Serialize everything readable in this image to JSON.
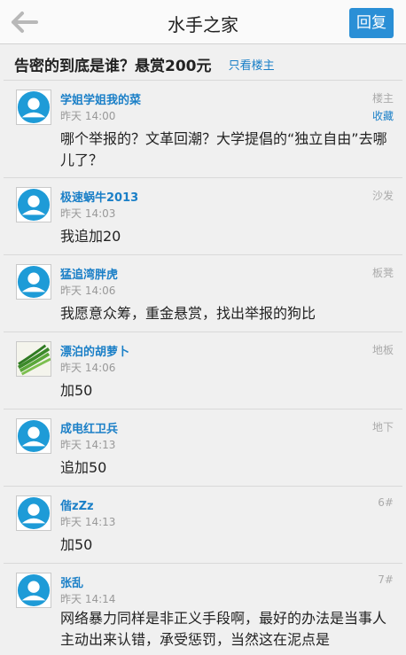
{
  "header": {
    "title": "水手之家",
    "reply_label": "回复"
  },
  "thread": {
    "title": "告密的到底是谁？悬赏200元",
    "only_op_label": "只看楼主"
  },
  "posts": [
    {
      "author": "学姐学姐我的菜",
      "time": "昨天 14:00",
      "floor": "楼主",
      "fav": "收藏",
      "content": "哪个举报的？文革回潮？大学提倡的“独立自由”去哪儿了？"
    },
    {
      "author": "极速蜗牛2013",
      "time": "昨天 14:03",
      "floor": "沙发",
      "content": "我追加20"
    },
    {
      "author": "猛追湾胖虎",
      "time": "昨天 14:06",
      "floor": "板凳",
      "content": "我愿意众筹，重金悬赏，找出举报的狗比"
    },
    {
      "author": "漂泊的胡萝卜",
      "time": "昨天 14:06",
      "floor": "地板",
      "content": "加50"
    },
    {
      "author": "成电红卫兵",
      "time": "昨天 14:13",
      "floor": "地下",
      "content": "追加50"
    },
    {
      "author": "偕zZz",
      "time": "昨天 14:13",
      "floor": "6#",
      "content": "加50"
    },
    {
      "author": "张乱",
      "time": "昨天 14:14",
      "floor": "7#",
      "content": "网络暴力同样是非正义手段啊，最好的办法是当事人主动出来认错，承受惩罚，当然这在泥点是"
    }
  ]
}
